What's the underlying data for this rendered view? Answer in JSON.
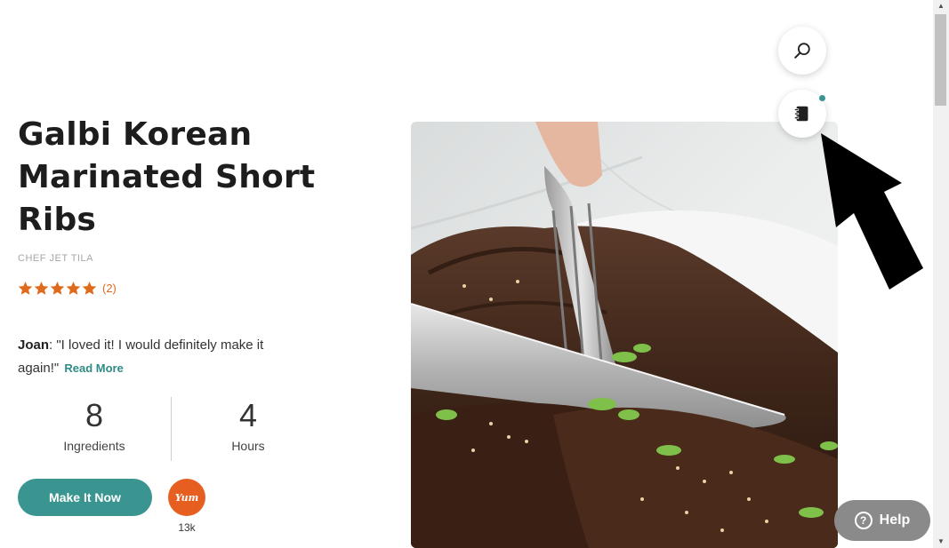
{
  "recipe": {
    "title": "Galbi Korean Marinated Short Ribs",
    "chef": "CHEF JET TILA",
    "rating_stars": 5,
    "rating_count": "(2)"
  },
  "review": {
    "reviewer": "Joan",
    "separator": ": ",
    "text": "\"I loved it! I would definitely make it again!\"",
    "read_more": "Read More"
  },
  "stats": {
    "ingredients_value": "8",
    "ingredients_label": "Ingredients",
    "hours_value": "4",
    "hours_label": "Hours"
  },
  "actions": {
    "make_it_now": "Make It Now",
    "yum_label": "Yum",
    "yum_count": "13k"
  },
  "floating": {
    "search_icon": "search-icon",
    "planner_icon": "meal-planner-icon"
  },
  "help": {
    "label": "Help",
    "icon": "?"
  },
  "colors": {
    "accent_teal": "#3a9590",
    "star_orange": "#e06a1b",
    "yum_orange": "#e65f20",
    "help_gray": "#8a8a8a"
  },
  "scrollbar": {
    "up_arrow": "▲",
    "down_arrow": "▼"
  }
}
